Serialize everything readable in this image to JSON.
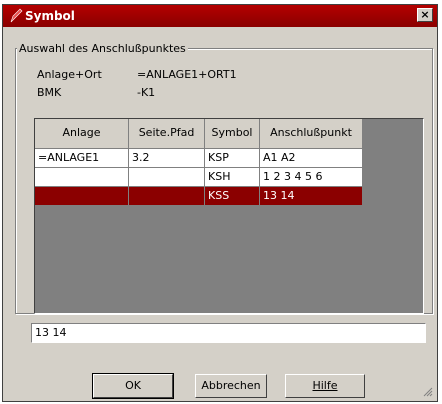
{
  "window": {
    "title": "Symbol",
    "close_glyph": "×",
    "accent_color": "#8b0000",
    "icon": "pencil-icon"
  },
  "group": {
    "legend": "Auswahl des Anschlußpunktes",
    "anlage_ort_label": "Anlage+Ort",
    "anlage_ort_value": "=ANLAGE1+ORT1",
    "bmk_label": "BMK",
    "bmk_value": "-K1"
  },
  "table": {
    "columns": [
      "Anlage",
      "Seite.Pfad",
      "Symbol",
      "Anschlußpunkt"
    ],
    "rows": [
      [
        "=ANLAGE1",
        "3.2",
        "KSP",
        "A1 A2"
      ],
      [
        "",
        "",
        "KSH",
        "1 2 3 4 5 6"
      ],
      [
        "",
        "",
        "KSS",
        "13 14"
      ]
    ],
    "selected_row": 2
  },
  "path_field": {
    "value": "13 14"
  },
  "buttons": {
    "ok": "OK",
    "abbrechen": "Abbrechen",
    "hilfe": "Hilfe"
  }
}
